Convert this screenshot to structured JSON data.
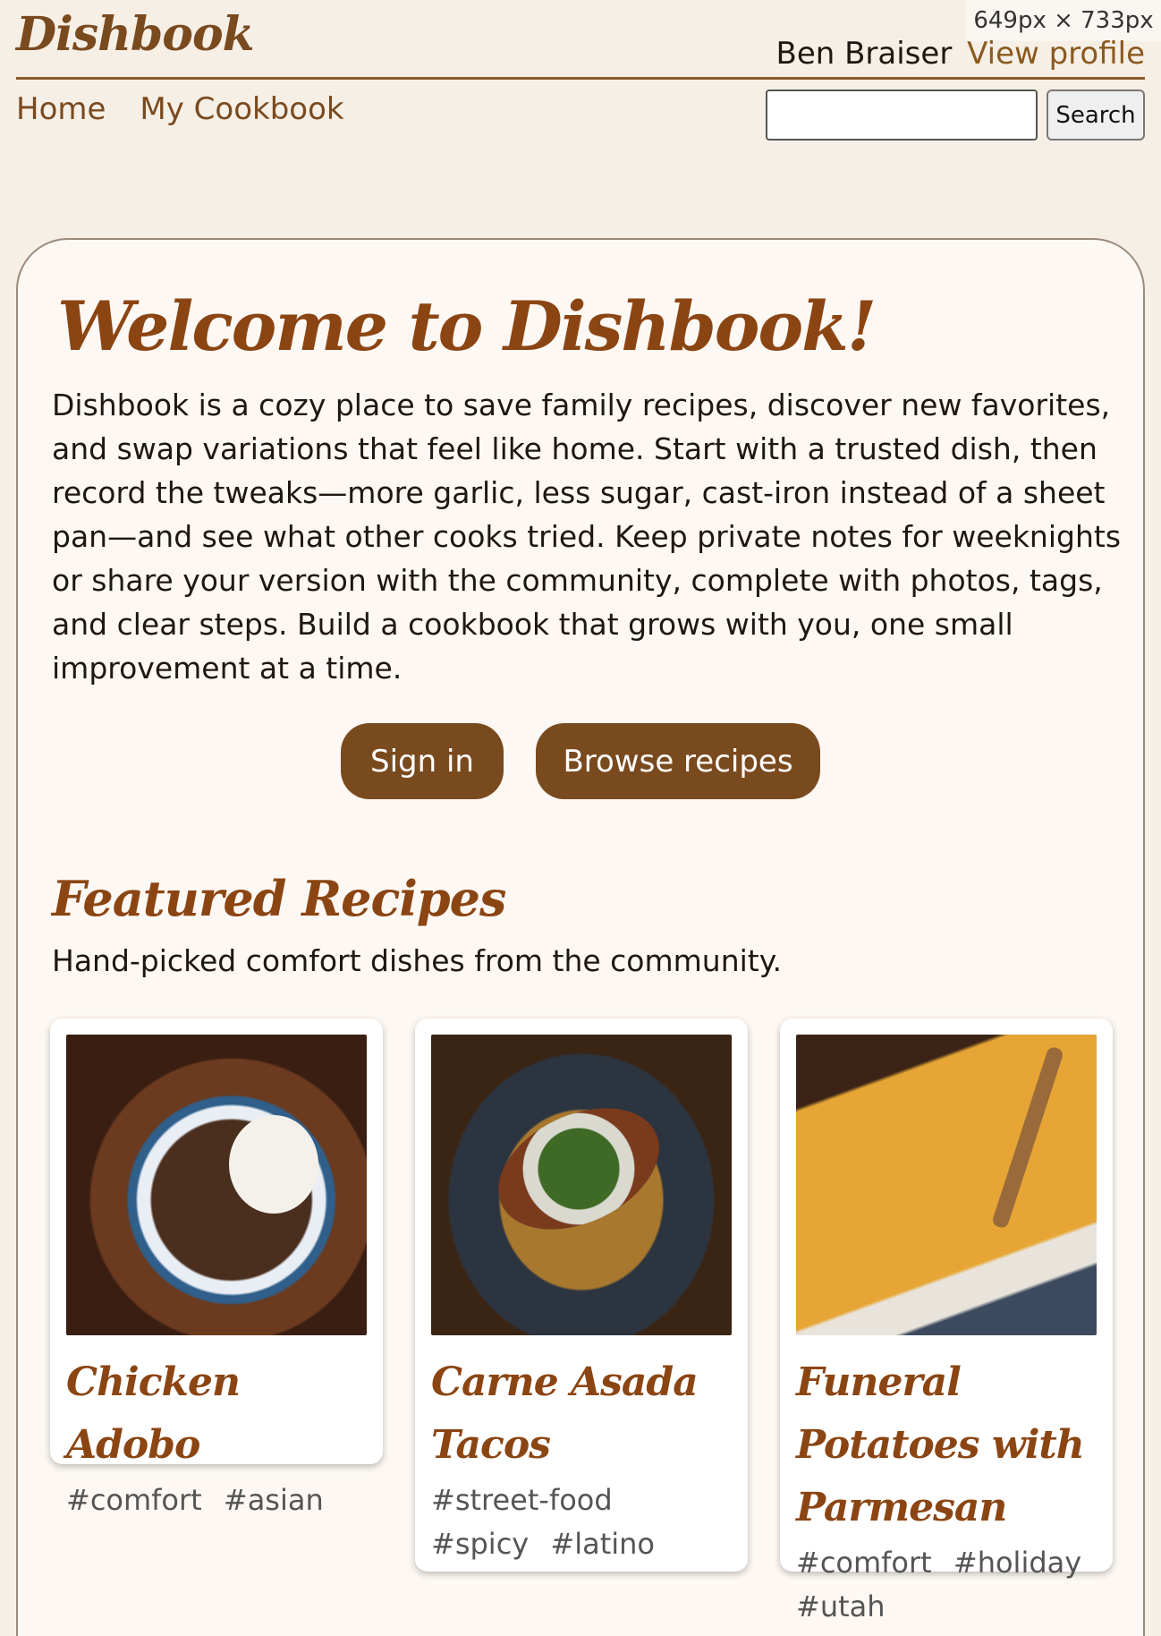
{
  "app": {
    "brand": "Dishbook"
  },
  "viewport_badge": "649px × 733px",
  "header": {
    "user_name": "Ben Braiser",
    "profile_link": "View profile"
  },
  "nav": {
    "items": [
      "Home",
      "My Cookbook"
    ]
  },
  "search": {
    "placeholder": "",
    "button_label": "Search"
  },
  "hero": {
    "title": "Welcome to Dishbook!",
    "body": "Dishbook is a cozy place to save family recipes, discover new favorites, and swap variations that feel like home. Start with a trusted dish, then record the tweaks—more garlic, less sugar, cast-iron instead of a sheet pan—and see what other cooks tried. Keep private notes for weeknights or share your version with the community, complete with photos, tags, and clear steps. Build a cookbook that grows with you, one small improvement at a time.",
    "signin_label": "Sign in",
    "browse_label": "Browse recipes"
  },
  "featured": {
    "title": "Featured Recipes",
    "subtitle": "Hand-picked comfort dishes from the community.",
    "recipes": [
      {
        "title": "Chicken Adobo",
        "tags": [
          "#comfort",
          "#asian"
        ],
        "image": "chicken-adobo"
      },
      {
        "title": "Carne Asada Tacos",
        "tags": [
          "#street-food",
          "#spicy",
          "#latino"
        ],
        "image": "carne-asada-tacos"
      },
      {
        "title": "Funeral Potatoes with Parmesan",
        "tags": [
          "#comfort",
          "#holiday",
          "#utah"
        ],
        "image": "funeral-potatoes"
      }
    ]
  },
  "colors": {
    "accent": "#7a4a1f",
    "heading": "#8b4513",
    "background": "#f6efe6",
    "card": "#fdf8f3"
  }
}
